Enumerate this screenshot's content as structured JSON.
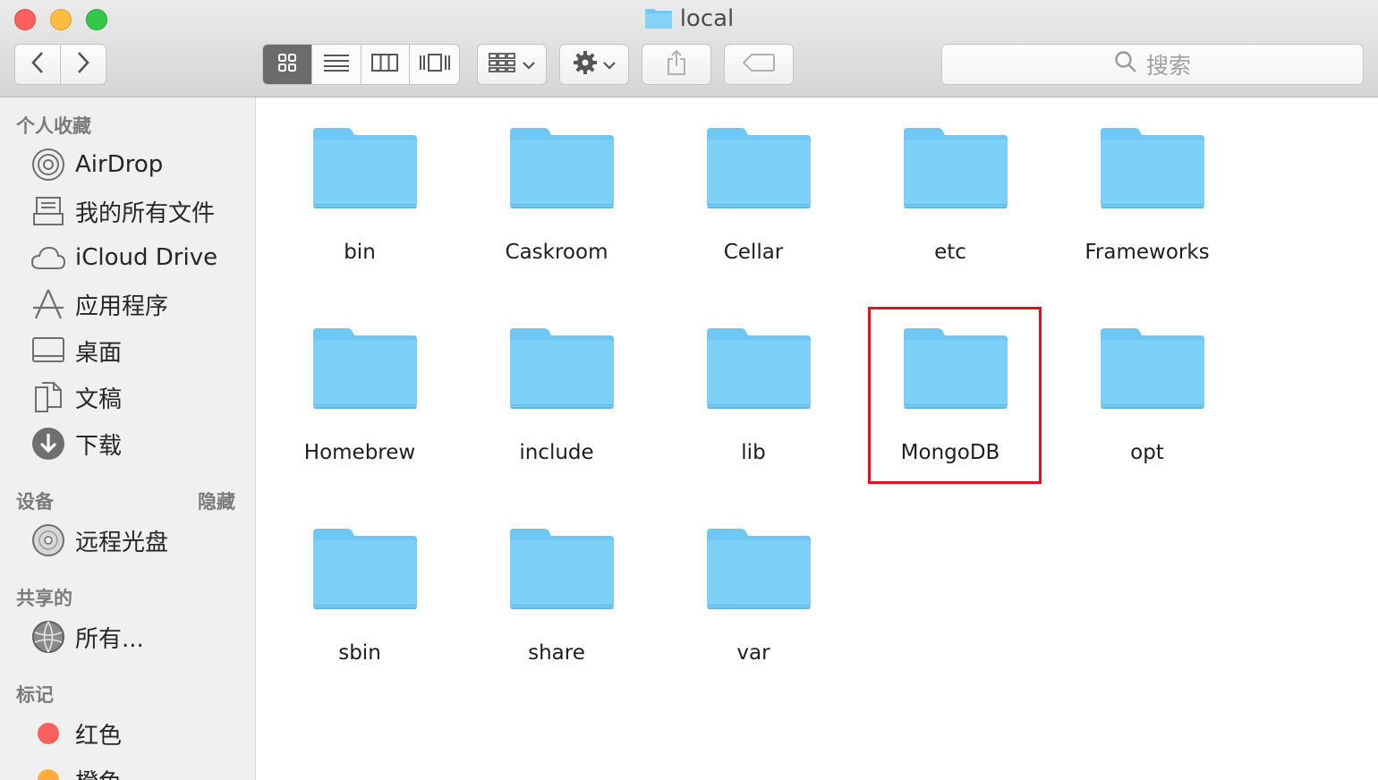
{
  "window": {
    "title": "local"
  },
  "search": {
    "placeholder": "搜索"
  },
  "sidebar": {
    "favorites_header": "个人收藏",
    "favorites": [
      {
        "label": "AirDrop",
        "icon": "airdrop-icon"
      },
      {
        "label": "我的所有文件",
        "icon": "all-files-icon"
      },
      {
        "label": "iCloud Drive",
        "icon": "cloud-icon"
      },
      {
        "label": "应用程序",
        "icon": "applications-icon"
      },
      {
        "label": "桌面",
        "icon": "desktop-icon"
      },
      {
        "label": "文稿",
        "icon": "documents-icon"
      },
      {
        "label": "下载",
        "icon": "download-icon"
      }
    ],
    "devices_header": "设备",
    "devices_hide": "隐藏",
    "devices": [
      {
        "label": "远程光盘",
        "icon": "disc-icon"
      }
    ],
    "shared_header": "共享的",
    "shared": [
      {
        "label": "所有...",
        "icon": "network-icon"
      }
    ],
    "tags_header": "标记",
    "tags": [
      {
        "label": "红色",
        "color": "#fc605c"
      },
      {
        "label": "橙色",
        "color": "#fdac3b"
      }
    ]
  },
  "folders": [
    {
      "name": "bin"
    },
    {
      "name": "Caskroom"
    },
    {
      "name": "Cellar"
    },
    {
      "name": "etc"
    },
    {
      "name": "Frameworks"
    },
    {
      "name": "Homebrew"
    },
    {
      "name": "include"
    },
    {
      "name": "lib"
    },
    {
      "name": "MongoDB",
      "highlighted": true
    },
    {
      "name": "opt"
    },
    {
      "name": "sbin"
    },
    {
      "name": "share"
    },
    {
      "name": "var"
    }
  ],
  "colors": {
    "folder": "#6fc8f4",
    "highlight": "#e0121f"
  }
}
